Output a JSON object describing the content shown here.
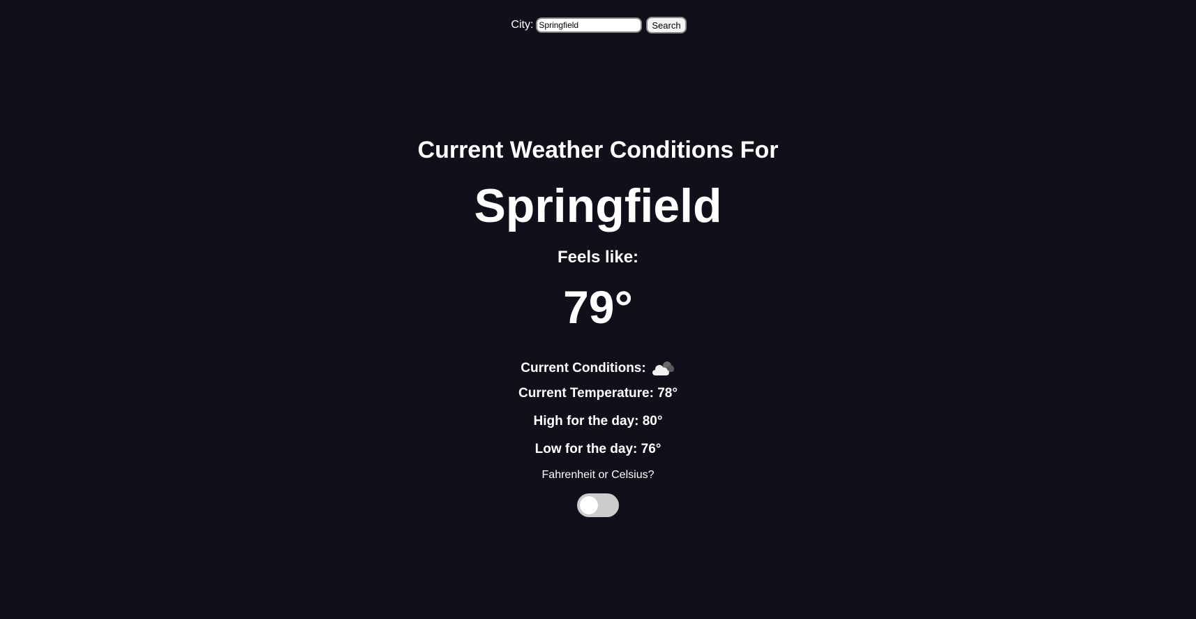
{
  "search": {
    "label": "City:",
    "value": "Springfield",
    "button_label": "Search"
  },
  "weather": {
    "heading": "Current Weather Conditions For",
    "city": "Springfield",
    "feels_like_label": "Feels like:",
    "feels_like_value": "79°",
    "conditions_label": "Current Conditions:",
    "conditions_icon": "partly-cloudy-icon",
    "current_temp_text": "Current Temperature: 78°",
    "high_text": "High for the day: 80°",
    "low_text": "Low for the day: 76°"
  },
  "units": {
    "question": "Fahrenheit or Celsius?",
    "toggle_checked": false
  },
  "colors": {
    "background": "#11101a",
    "text": "#ffffff",
    "toggle_track": "#cccccc"
  }
}
